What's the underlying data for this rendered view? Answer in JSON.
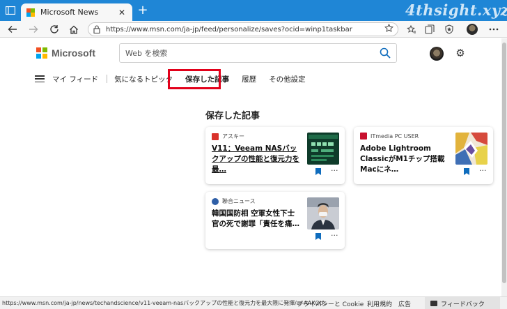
{
  "browser": {
    "tab_title": "Microsoft News",
    "tab_close": "✕",
    "new_tab": "+",
    "watermark": "4thsight.xyz",
    "url": "https://www.msn.com/ja-jp/feed/personalize/saves?ocid=winp1taskbar"
  },
  "header": {
    "brand": "Microsoft",
    "search_placeholder": "Web を検索"
  },
  "feed_nav": {
    "items": [
      "マイ フィード",
      "気になるトピック",
      "保存した記事",
      "履歴",
      "その他設定"
    ],
    "active": "保存した記事"
  },
  "section": {
    "title": "保存した記事"
  },
  "cards": [
    {
      "source": "アスキー",
      "headline": "V11：Veeam NASバックアップの性能と復元力を最…",
      "source_color": "#d9322b"
    },
    {
      "source": "ITmedia PC USER",
      "headline": "Adobe Lightroom ClassicがM1チップ搭載Macにネ…",
      "source_color": "#c8102e"
    },
    {
      "source": "聯合ニュース",
      "headline": "韓国国防相 空軍女性下士官の死で謝罪「責任を痛…",
      "source_color": "#2f5fa7"
    }
  ],
  "card_more": "···",
  "status_bar": {
    "url": "https://www.msn.com/ja-jp/news/techandscience/v11-veeam-nasバックアップの性能と復元力を最大限に発揮/ar-AAKQtfs",
    "links": [
      "プライバシーと Cookie",
      "利用規約",
      "広告"
    ],
    "feedback": "フィードバック"
  },
  "colors": {
    "titlebar": "#1f86d6",
    "accent_blue": "#0f6cbd",
    "highlight_red": "#e2001a"
  }
}
